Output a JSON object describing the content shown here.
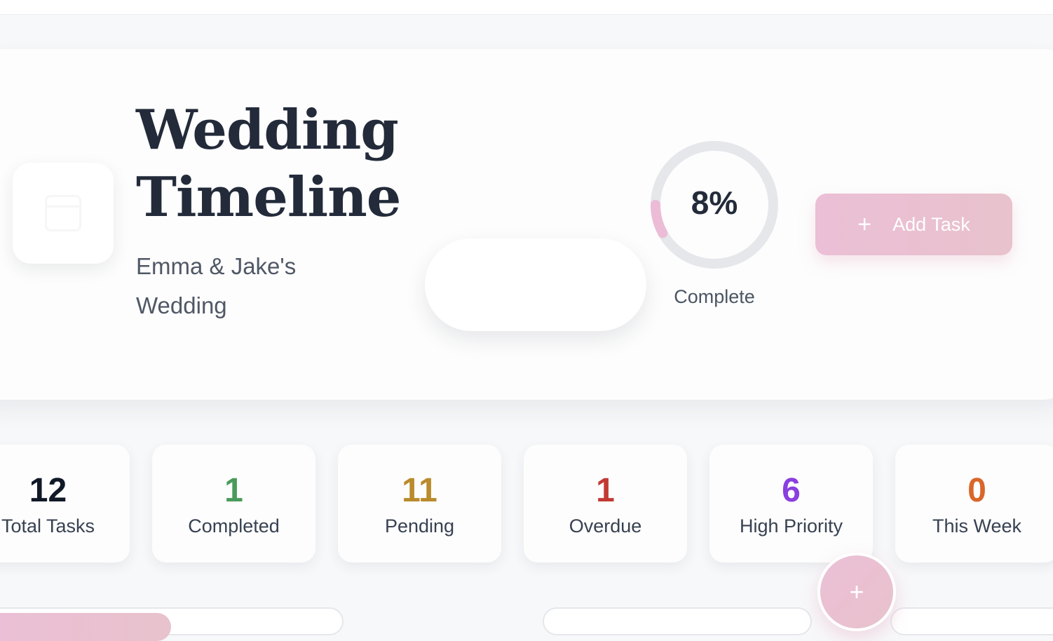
{
  "header": {
    "title": "Wedding Timeline",
    "subtitle": "Emma & Jake's Wedding"
  },
  "progress": {
    "value_text": "8%",
    "fraction": 0.08,
    "label": "Complete",
    "track_color": "#e5e7eb",
    "fill_color": "#ecbcd6"
  },
  "actions": {
    "add_task_label": "Add Task",
    "add_icon": "plus-icon",
    "fab_icon": "plus-icon"
  },
  "stats": [
    {
      "value": "12",
      "label": "Total Tasks",
      "color": "#111827"
    },
    {
      "value": "1",
      "label": "Completed",
      "color": "#4a9b5a"
    },
    {
      "value": "11",
      "label": "Pending",
      "color": "#b98b2c"
    },
    {
      "value": "1",
      "label": "Overdue",
      "color": "#c23a35"
    },
    {
      "value": "6",
      "label": "High Priority",
      "color": "#8a3fe0"
    },
    {
      "value": "0",
      "label": "This Week",
      "color": "#d9662a"
    }
  ],
  "colors": {
    "accent_gradient_start": "#ebbfd6",
    "accent_gradient_end": "#e8c2cc",
    "page_background": "#f7f8fa"
  }
}
